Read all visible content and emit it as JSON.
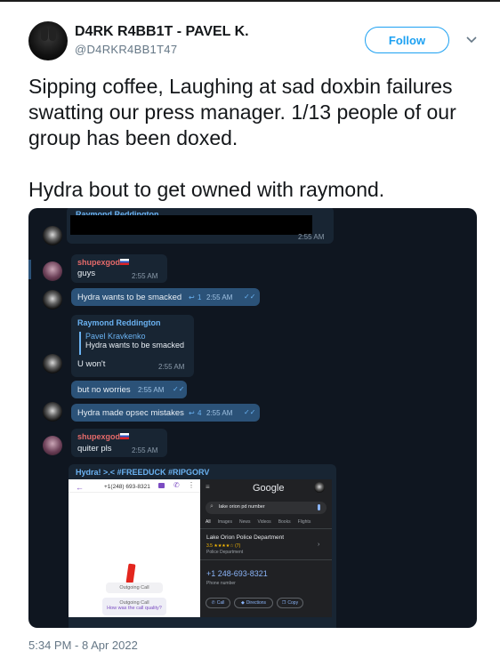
{
  "header": {
    "display_name": "D4RK R4BB1T - PAVEL K.",
    "handle": "@D4RKR4BB1T47",
    "follow_label": "Follow"
  },
  "tweet": {
    "text": "Sipping coffee, Laughing at sad doxbin failures swatting our press manager. 1/13 people of our group has been doxed.\n\nHydra bout to get owned with raymond.",
    "timestamp": "5:34 PM - 8 Apr 2022"
  },
  "chat": {
    "msg1": {
      "name": "Raymond Reddington",
      "time": "2:55 AM"
    },
    "msg2": {
      "name": "shupexgod",
      "text": "guys",
      "time": "2:55 AM"
    },
    "msg3": {
      "text": "Hydra wants to be smacked",
      "replies": "1",
      "time": "2:55 AM"
    },
    "msg4": {
      "name": "Raymond Reddington",
      "quote_name": "Pavel Kravkenko",
      "quote_text": "Hydra wants to be smacked",
      "text": "U won't",
      "time": "2:55 AM"
    },
    "msg5": {
      "text": "but no worries",
      "time": "2:55 AM"
    },
    "msg6": {
      "text": "Hydra made opsec mistakes",
      "replies": "4",
      "time": "2:55 AM"
    },
    "msg7": {
      "name": "shupexgod",
      "text": "quiter pls",
      "time": "2:55 AM"
    },
    "msg8": {
      "caption": "Hydra! >.< #FREEDUCK #RIPGORV"
    }
  },
  "screenshot_left": {
    "number": "+1(248) 693-8321",
    "outgoing1": "Outgoing Call",
    "outgoing2": "Outgoing Call",
    "quality": "How was the call quality?"
  },
  "screenshot_right": {
    "brand": "Google",
    "search": "lake orion pd number",
    "tabs": [
      "All",
      "Images",
      "News",
      "Videos",
      "Books",
      "Flights"
    ],
    "place": "Lake Orion Police Department",
    "rating": "3.5 ★★★★☆ (7)",
    "category": "Police Department",
    "phone": "+1 248-693-8321",
    "phone_label": "Phone number",
    "actions": [
      "Call",
      "Directions",
      "Copy"
    ]
  },
  "colors": {
    "accent": "#1da1f2",
    "chat_bg": "#0f1620",
    "bubble_in": "#182533",
    "bubble_out": "#2b5278"
  },
  "icons": [
    "chevron-down-icon",
    "reply-icon",
    "double-check-icon",
    "back-arrow-icon",
    "video-icon",
    "phone-icon",
    "more-icon",
    "menu-icon",
    "search-icon",
    "mic-icon",
    "call-icon",
    "directions-icon",
    "copy-icon"
  ]
}
